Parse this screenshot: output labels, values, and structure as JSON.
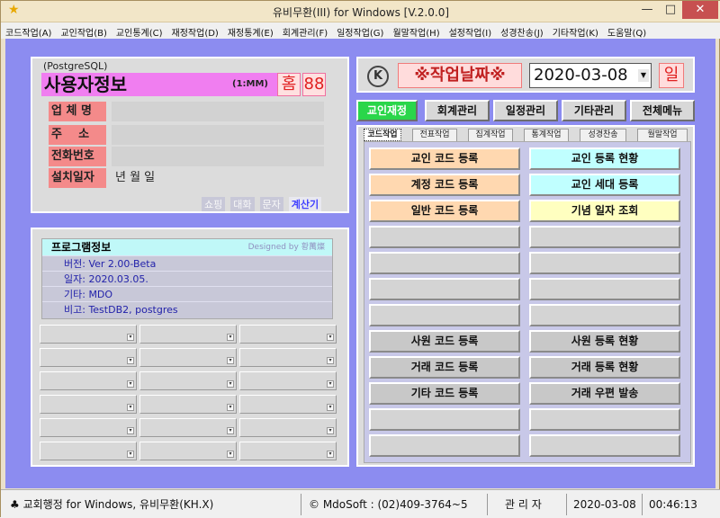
{
  "window": {
    "title": "유비무환(III) for Windows [V.2.0.0]",
    "min_glyph": "—",
    "max_glyph": "□",
    "close_glyph": "✕",
    "icon": "star-icon"
  },
  "menu": [
    "코드작업(A)",
    "교인작업(B)",
    "교인통계(C)",
    "재정작업(D)",
    "재정통계(E)",
    "회계관리(F)",
    "일정작업(G)",
    "월말작업(H)",
    "설정작업(I)",
    "성경찬송(J)",
    "기타작업(K)",
    "도움말(Q)"
  ],
  "user_panel": {
    "db": "(PostgreSQL)",
    "title": "사용자정보",
    "mode": "(1:MM)",
    "home": "홈",
    "number": "88",
    "fields": [
      {
        "label": "업 체 명",
        "value": ""
      },
      {
        "label": "주    소",
        "value": ""
      },
      {
        "label": "전화번호",
        "value": ""
      },
      {
        "label": "설치일자",
        "value": "년 월 일"
      }
    ],
    "links": [
      {
        "label": "쇼핑",
        "active": false
      },
      {
        "label": "대화",
        "active": false
      },
      {
        "label": "문자",
        "active": false
      },
      {
        "label": "계산기",
        "active": true
      }
    ]
  },
  "program_info": {
    "title": "프로그램정보",
    "designed_by": "Designed by 황萬燦",
    "lines": [
      "버전: Ver 2.00-Beta",
      "일자: 2020.03.05.",
      "기타: MDO",
      "비고: TestDB2, postgres"
    ]
  },
  "work_date": {
    "label": "※작업날짜※",
    "date": "2020-03-08",
    "day": "일",
    "k_icon": "K"
  },
  "top_buttons": [
    {
      "label": "교인재정",
      "active": true
    },
    {
      "label": "회계관리",
      "active": false
    },
    {
      "label": "일정관리",
      "active": false
    },
    {
      "label": "기타관리",
      "active": false
    },
    {
      "label": "전체메뉴",
      "active": false
    }
  ],
  "tabs": [
    "코드작업",
    "전표작업",
    "집계작업",
    "통계작업",
    "성경찬송",
    "월말작업"
  ],
  "code_buttons": {
    "left": [
      "교인 코드 등록",
      "계정 코드 등록",
      "일반 코드 등록",
      "",
      "",
      "",
      "",
      "사원 코드 등록",
      "거래 코드 등록",
      "기타 코드 등록",
      "",
      ""
    ],
    "right": [
      "교인 등록 현황",
      "교인 세대 등록",
      "기념 일자 조회",
      "",
      "",
      "",
      "",
      "사원 등록 현황",
      "거래 등록 현황",
      "거래 우편 발송",
      "",
      ""
    ]
  },
  "status": {
    "app": "♣ 교회행정 for Windows, 유비무환(KH.X)",
    "company": "© MdoSoft : (02)409-3764~5",
    "user": "관 리 자",
    "date": "2020-03-08",
    "time": "00:46:13"
  },
  "colors": {
    "client_bg": "#8c8cf0",
    "accent_green": "#2ad64a",
    "user_title_bg": "#f07ef0",
    "label_bg": "#f48a8a"
  }
}
